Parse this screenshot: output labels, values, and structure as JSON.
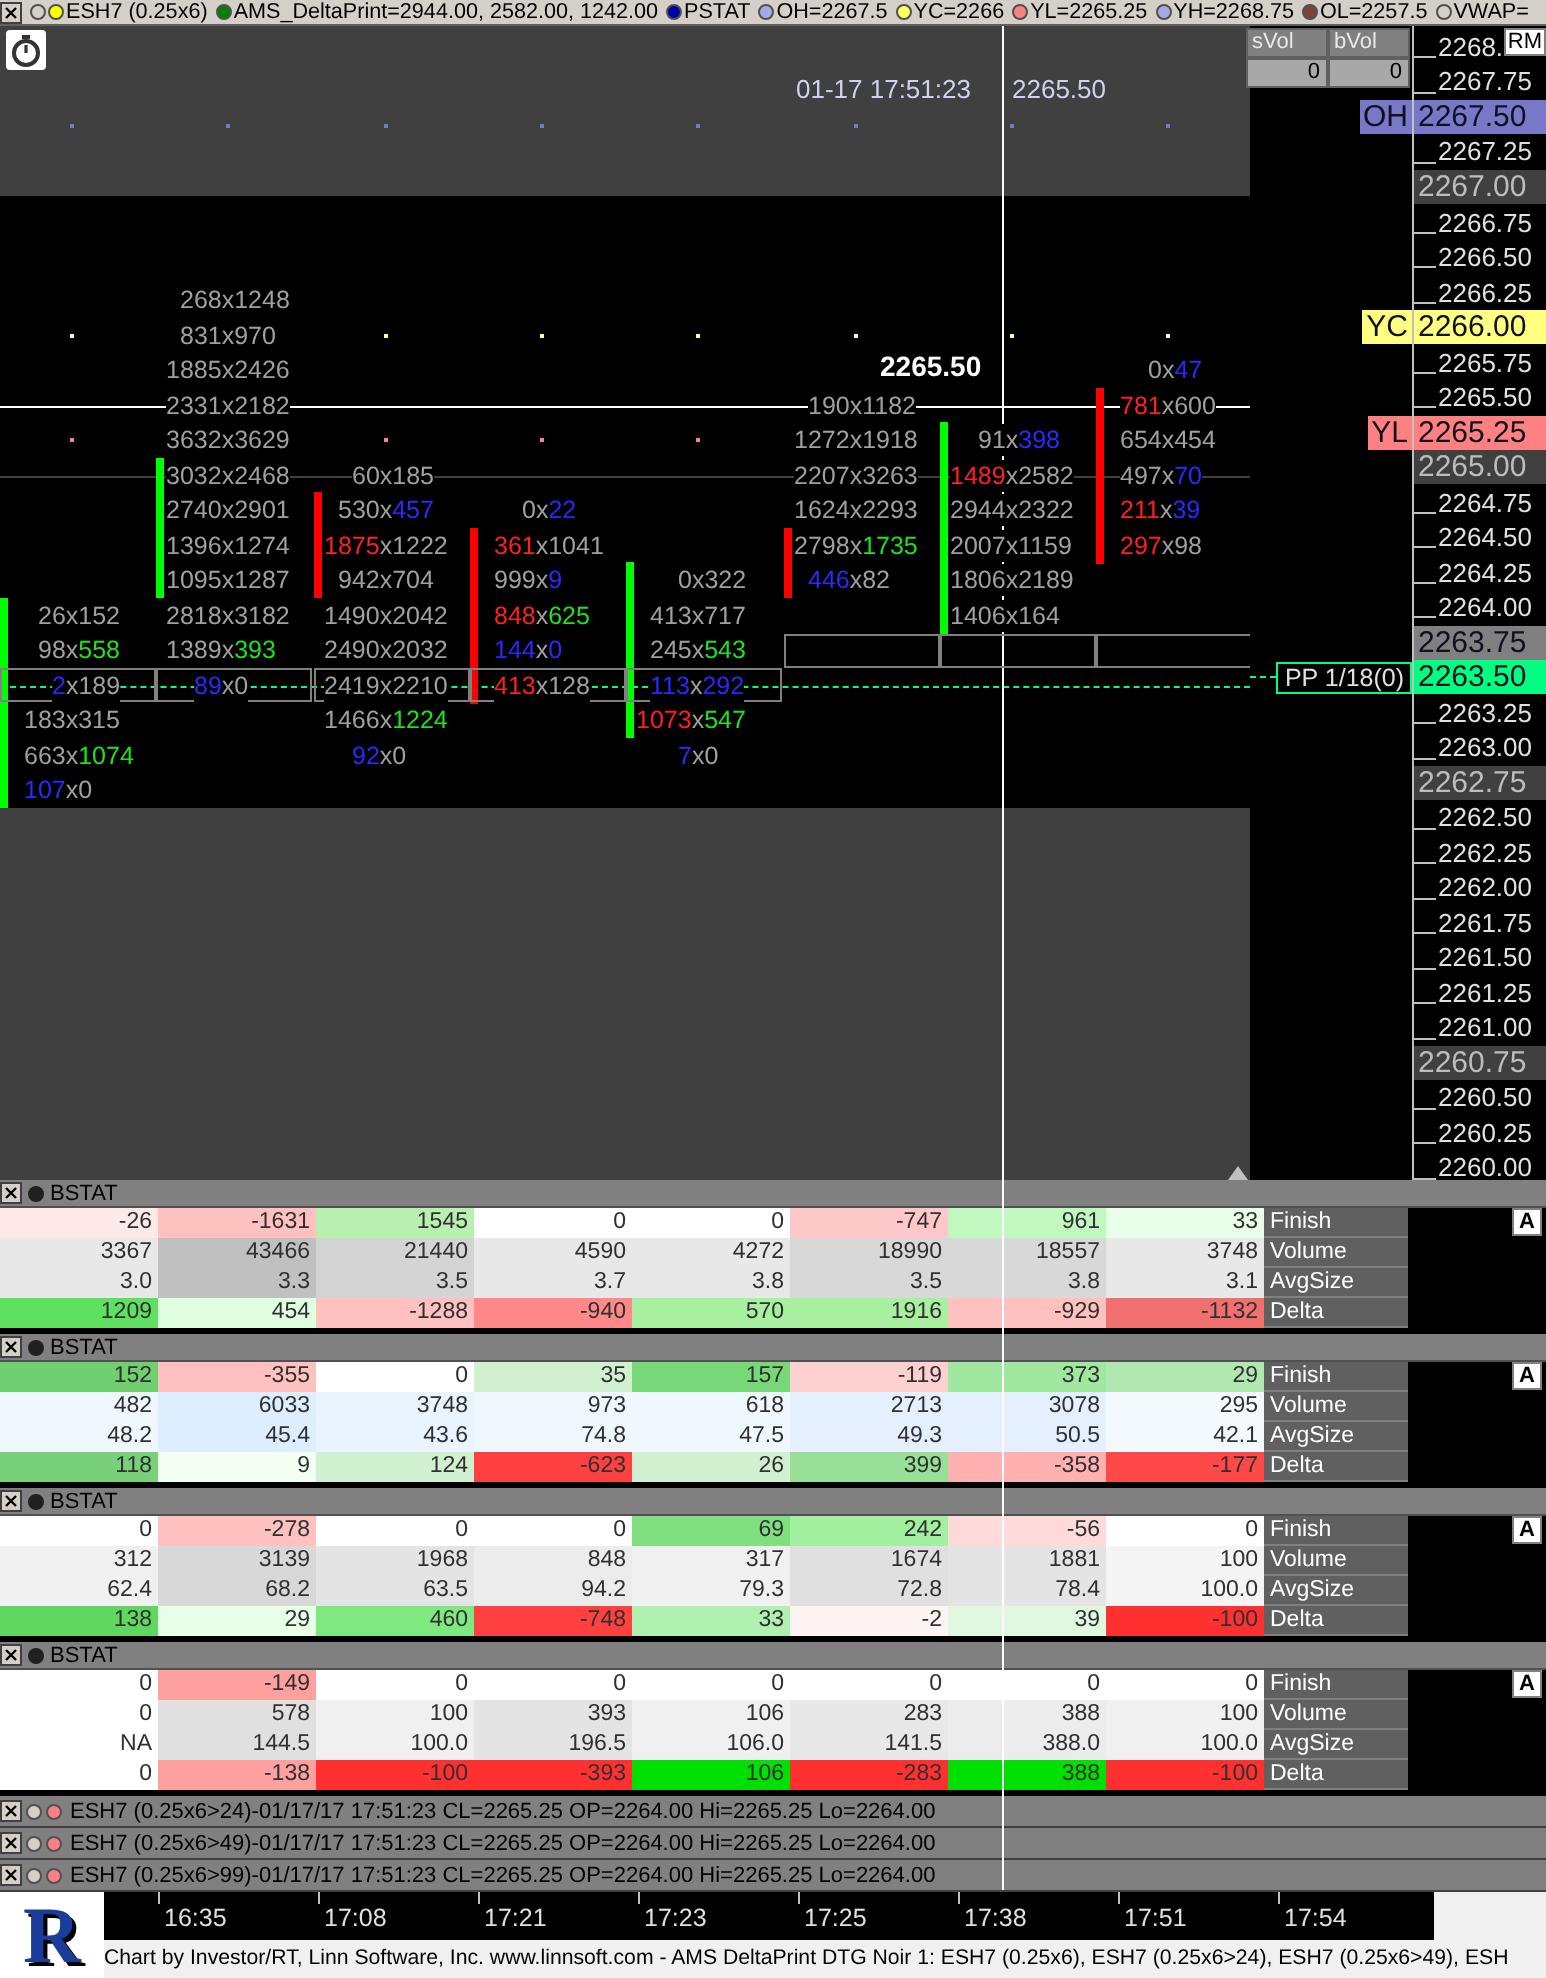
{
  "legend": {
    "items": [
      {
        "dots": [
          {
            "color": "#d4d0c8"
          },
          {
            "color": "#ffff00"
          }
        ],
        "text": "ESH7 (0.25x6)"
      },
      {
        "dots": [
          {
            "color": "#008000"
          }
        ],
        "text": "AMS_DeltaPrint=2944.00, 2582.00, 1242.00"
      },
      {
        "dots": [
          {
            "color": "#0000a0"
          }
        ],
        "text": "PSTAT"
      },
      {
        "dots": [
          {
            "color": "#a8a8e8"
          }
        ],
        "text": "OH=2267.5"
      },
      {
        "dots": [
          {
            "color": "#ffff60"
          }
        ],
        "text": "YC=2266"
      },
      {
        "dots": [
          {
            "color": "#ff8080"
          }
        ],
        "text": "YL=2265.25"
      },
      {
        "dots": [
          {
            "color": "#a8a8e8"
          }
        ],
        "text": "YH=2268.75"
      },
      {
        "dots": [
          {
            "color": "#804040"
          }
        ],
        "text": "OL=2257.5"
      },
      {
        "dots": [
          {
            "color": "#d4d0c8"
          }
        ],
        "text": "VWAP="
      }
    ]
  },
  "chart": {
    "crosshair": {
      "time": "01-17 17:51:23",
      "price": "2265.50",
      "label": "2265.50"
    },
    "volume_table": {
      "columns": [
        "sVol",
        "bVol"
      ],
      "values": [
        "0",
        "0"
      ]
    },
    "axis_button": "RM",
    "ticks": [
      {
        "label": "2268.",
        "kind": "plain"
      },
      {
        "label": "2267.75",
        "kind": "plain"
      },
      {
        "label": "2267.50",
        "color": "#7878c8",
        "tag": "OH",
        "kind": "tag_dots"
      },
      {
        "label": "2267.25",
        "kind": "plain"
      },
      {
        "label": "2267.00",
        "color": "#404040",
        "kind": "range_edge"
      },
      {
        "label": "2266.75",
        "kind": "plain"
      },
      {
        "label": "2266.50",
        "kind": "plain"
      },
      {
        "label": "2266.25",
        "kind": "plain"
      },
      {
        "label": "2266.00",
        "color": "#ffff80",
        "tag": "YC",
        "kind": "tag_dots"
      },
      {
        "label": "2265.75",
        "kind": "plain"
      },
      {
        "label": "2265.50",
        "kind": "crosshair"
      },
      {
        "label": "2265.25",
        "color": "#ff8080",
        "tag": "YL",
        "kind": "tag_dots"
      },
      {
        "label": "2265.00",
        "color": "#404040",
        "kind": "line"
      },
      {
        "label": "2264.75",
        "kind": "plain"
      },
      {
        "label": "2264.50",
        "kind": "plain"
      },
      {
        "label": "2264.25",
        "kind": "plain"
      },
      {
        "label": "2264.00",
        "kind": "plain"
      },
      {
        "label": "2263.75",
        "color": "#808080",
        "kind": "plain"
      },
      {
        "label": "2263.50",
        "color": "#00ff80",
        "tag": "PP 1/18(0)",
        "kind": "tag_dashed"
      },
      {
        "label": "2263.25",
        "kind": "plain"
      },
      {
        "label": "2263.00",
        "kind": "plain"
      },
      {
        "label": "2262.75",
        "color": "#404040",
        "kind": "range_edge"
      },
      {
        "label": "2262.50",
        "kind": "plain"
      },
      {
        "label": "2262.25",
        "kind": "plain"
      },
      {
        "label": "2262.00",
        "kind": "plain"
      },
      {
        "label": "2261.75",
        "kind": "plain"
      },
      {
        "label": "2261.50",
        "kind": "plain"
      },
      {
        "label": "2261.25",
        "kind": "plain"
      },
      {
        "label": "2261.00",
        "kind": "plain"
      },
      {
        "label": "2260.75",
        "color": "#404040",
        "kind": "plain"
      },
      {
        "label": "2260.50",
        "kind": "plain"
      },
      {
        "label": "2260.25",
        "kind": "plain"
      },
      {
        "label": "2260.00",
        "kind": "plain"
      }
    ],
    "footprint": {
      "columns": [
        {
          "color": "#00ff00",
          "cells": [
            null,
            null,
            null,
            null,
            null,
            null,
            null,
            null,
            null,
            {
              "text": "26x152",
              "bid": {
                "color": "#a0a0a0"
              },
              "ask": {
                "color": "#a0a0a0"
              },
              "body": true,
              "outlined": false
            },
            {
              "text": "98x558",
              "bid": {
                "color": "#a0a0a0"
              },
              "ask": {
                "color": "#20e020"
              },
              "body": true,
              "outlined": false
            },
            {
              "text": "2x189",
              "bid": {
                "color": "#2a2aff"
              },
              "ask": {
                "color": "#a0a0a0"
              },
              "body": true,
              "outlined": true
            },
            {
              "text": "183x315",
              "bid": {
                "color": "#a0a0a0"
              },
              "ask": {
                "color": "#a0a0a0"
              },
              "body": true,
              "outlined": false
            },
            {
              "text": "663x1074",
              "bid": {
                "color": "#a0a0a0"
              },
              "ask": {
                "color": "#20e020"
              },
              "body": true,
              "outlined": false
            },
            {
              "text": "107x0",
              "bid": {
                "color": "#2a2aff"
              },
              "ask": {
                "color": "#a0a0a0"
              },
              "body": true,
              "outlined": false
            }
          ]
        },
        {
          "color": "#00ff00",
          "cells": [
            {
              "text": "268x1248",
              "bid": {
                "color": "#a0a0a0"
              },
              "ask": {
                "color": "#a0a0a0"
              },
              "body": false,
              "outlined": false
            },
            {
              "text": "831x970",
              "bid": {
                "color": "#a0a0a0"
              },
              "ask": {
                "color": "#a0a0a0"
              },
              "body": false,
              "outlined": false
            },
            {
              "text": "1885x2426",
              "bid": {
                "color": "#a0a0a0"
              },
              "ask": {
                "color": "#a0a0a0"
              },
              "body": false,
              "outlined": false
            },
            {
              "text": "2331x2182",
              "bid": {
                "color": "#a0a0a0"
              },
              "ask": {
                "color": "#a0a0a0"
              },
              "body": false,
              "outlined": false
            },
            {
              "text": "3632x3629",
              "bid": {
                "color": "#a0a0a0"
              },
              "ask": {
                "color": "#a0a0a0"
              },
              "body": false,
              "outlined": false
            },
            {
              "text": "3032x2468",
              "bid": {
                "color": "#a0a0a0"
              },
              "ask": {
                "color": "#a0a0a0"
              },
              "body": true,
              "outlined": false
            },
            {
              "text": "2740x2901",
              "bid": {
                "color": "#a0a0a0"
              },
              "ask": {
                "color": "#a0a0a0"
              },
              "body": true,
              "outlined": false
            },
            {
              "text": "1396x1274",
              "bid": {
                "color": "#a0a0a0"
              },
              "ask": {
                "color": "#a0a0a0"
              },
              "body": true,
              "outlined": false
            },
            {
              "text": "1095x1287",
              "bid": {
                "color": "#a0a0a0"
              },
              "ask": {
                "color": "#a0a0a0"
              },
              "body": true,
              "outlined": false
            },
            {
              "text": "2818x3182",
              "bid": {
                "color": "#a0a0a0"
              },
              "ask": {
                "color": "#a0a0a0"
              },
              "body": false,
              "outlined": false
            },
            {
              "text": "1389x393",
              "bid": {
                "color": "#a0a0a0"
              },
              "ask": {
                "color": "#20e020"
              },
              "body": false,
              "outlined": false
            },
            {
              "text": "89x0",
              "bid": {
                "color": "#2a2aff"
              },
              "ask": {
                "color": "#a0a0a0"
              },
              "body": false,
              "outlined": true
            }
          ]
        },
        {
          "color": "#ff0000",
          "cells": [
            null,
            null,
            null,
            null,
            null,
            {
              "text": "60x185",
              "bid": {
                "color": "#a0a0a0"
              },
              "ask": {
                "color": "#a0a0a0"
              },
              "body": false,
              "outlined": false
            },
            {
              "text": "530x457",
              "bid": {
                "color": "#a0a0a0"
              },
              "ask": {
                "color": "#2a2aff"
              },
              "body": true,
              "outlined": false
            },
            {
              "text": "1875x1222",
              "bid": {
                "color": "#ff2020"
              },
              "ask": {
                "color": "#a0a0a0"
              },
              "body": true,
              "outlined": false
            },
            {
              "text": "942x704",
              "bid": {
                "color": "#a0a0a0"
              },
              "ask": {
                "color": "#a0a0a0"
              },
              "body": true,
              "outlined": false
            },
            {
              "text": "1490x2042",
              "bid": {
                "color": "#a0a0a0"
              },
              "ask": {
                "color": "#a0a0a0"
              },
              "body": false,
              "outlined": false
            },
            {
              "text": "2490x2032",
              "bid": {
                "color": "#a0a0a0"
              },
              "ask": {
                "color": "#a0a0a0"
              },
              "body": false,
              "outlined": false
            },
            {
              "text": "2419x2210",
              "bid": {
                "color": "#a0a0a0"
              },
              "ask": {
                "color": "#a0a0a0"
              },
              "body": false,
              "outlined": true
            },
            {
              "text": "1466x1224",
              "bid": {
                "color": "#a0a0a0"
              },
              "ask": {
                "color": "#20e020"
              },
              "body": false,
              "outlined": false
            },
            {
              "text": "92x0",
              "bid": {
                "color": "#2a2aff"
              },
              "ask": {
                "color": "#a0a0a0"
              },
              "body": false,
              "outlined": false
            }
          ]
        },
        {
          "color": "#ff0000",
          "cells": [
            null,
            null,
            null,
            null,
            null,
            null,
            {
              "text": "0x22",
              "bid": {
                "color": "#a0a0a0"
              },
              "ask": {
                "color": "#2a2aff"
              },
              "body": false,
              "outlined": false
            },
            {
              "text": "361x1041",
              "bid": {
                "color": "#ff2020"
              },
              "ask": {
                "color": "#a0a0a0"
              },
              "body": true,
              "outlined": false
            },
            {
              "text": "999x9",
              "bid": {
                "color": "#a0a0a0"
              },
              "ask": {
                "color": "#2a2aff"
              },
              "body": true,
              "outlined": false
            },
            {
              "text": "848x625",
              "bid": {
                "color": "#ff2020"
              },
              "ask": {
                "color": "#20e020"
              },
              "body": true,
              "outlined": false
            },
            {
              "text": "144x0",
              "bid": {
                "color": "#2a2aff"
              },
              "ask": {
                "color": "#2a2aff"
              },
              "body": true,
              "outlined": false
            },
            {
              "text": "413x128",
              "bid": {
                "color": "#ff2020"
              },
              "ask": {
                "color": "#a0a0a0"
              },
              "body": true,
              "outlined": true
            }
          ]
        },
        {
          "color": "#00ff00",
          "cells": [
            null,
            null,
            null,
            null,
            null,
            null,
            null,
            null,
            {
              "text": "0x322",
              "bid": {
                "color": "#a0a0a0"
              },
              "ask": {
                "color": "#a0a0a0"
              },
              "body": true,
              "outlined": false
            },
            {
              "text": "413x717",
              "bid": {
                "color": "#a0a0a0"
              },
              "ask": {
                "color": "#a0a0a0"
              },
              "body": true,
              "outlined": false
            },
            {
              "text": "245x543",
              "bid": {
                "color": "#a0a0a0"
              },
              "ask": {
                "color": "#20e020"
              },
              "body": true,
              "outlined": false
            },
            {
              "text": "113x292",
              "bid": {
                "color": "#2a2aff"
              },
              "ask": {
                "color": "#2a2aff"
              },
              "body": true,
              "outlined": true
            },
            {
              "text": "1073x547",
              "bid": {
                "color": "#ff2020"
              },
              "ask": {
                "color": "#20e020"
              },
              "body": true,
              "outlined": false
            },
            {
              "text": "7x0",
              "bid": {
                "color": "#2a2aff"
              },
              "ask": {
                "color": "#a0a0a0"
              },
              "body": false,
              "outlined": false
            }
          ]
        },
        {
          "color": "#ff0000",
          "cells": [
            null,
            null,
            null,
            {
              "text": "190x1182",
              "bid": {
                "color": "#a0a0a0"
              },
              "ask": {
                "color": "#a0a0a0"
              },
              "body": false,
              "outlined": false
            },
            {
              "text": "1272x1918",
              "bid": {
                "color": "#a0a0a0"
              },
              "ask": {
                "color": "#a0a0a0"
              },
              "body": false,
              "outlined": false
            },
            {
              "text": "2207x3263",
              "bid": {
                "color": "#a0a0a0"
              },
              "ask": {
                "color": "#a0a0a0"
              },
              "body": false,
              "outlined": false
            },
            {
              "text": "1624x2293",
              "bid": {
                "color": "#a0a0a0"
              },
              "ask": {
                "color": "#a0a0a0"
              },
              "body": false,
              "outlined": false
            },
            {
              "text": "2798x1735",
              "bid": {
                "color": "#a0a0a0"
              },
              "ask": {
                "color": "#20e020"
              },
              "body": true,
              "outlined": false
            },
            {
              "text": "446x82",
              "bid": {
                "color": "#2a2aff"
              },
              "ask": {
                "color": "#a0a0a0"
              },
              "body": true,
              "outlined": false
            },
            null,
            {
              "body": false,
              "outlined": true
            }
          ]
        },
        {
          "color": "#00ff00",
          "cells": [
            null,
            null,
            null,
            null,
            {
              "text": "91x398",
              "bid": {
                "color": "#a0a0a0"
              },
              "ask": {
                "color": "#2a2aff"
              },
              "body": true,
              "outlined": false
            },
            {
              "text": "1489x2582",
              "bid": {
                "color": "#ff2020"
              },
              "ask": {
                "color": "#a0a0a0"
              },
              "body": true,
              "outlined": false
            },
            {
              "text": "2944x2322",
              "bid": {
                "color": "#a0a0a0"
              },
              "ask": {
                "color": "#a0a0a0"
              },
              "body": true,
              "outlined": false
            },
            {
              "text": "2007x1159",
              "bid": {
                "color": "#a0a0a0"
              },
              "ask": {
                "color": "#a0a0a0"
              },
              "body": true,
              "outlined": false
            },
            {
              "text": "1806x2189",
              "bid": {
                "color": "#a0a0a0"
              },
              "ask": {
                "color": "#a0a0a0"
              },
              "body": true,
              "outlined": false
            },
            {
              "text": "1406x164",
              "bid": {
                "color": "#a0a0a0"
              },
              "ask": {
                "color": "#a0a0a0"
              },
              "body": true,
              "outlined": false
            },
            {
              "body": false,
              "outlined": true
            }
          ]
        },
        {
          "color": "#ff0000",
          "cells": [
            null,
            null,
            {
              "text": "0x47",
              "bid": {
                "color": "#a0a0a0"
              },
              "ask": {
                "color": "#2a2aff"
              },
              "body": false,
              "outlined": false
            },
            {
              "text": "781x600",
              "bid": {
                "color": "#ff2020"
              },
              "ask": {
                "color": "#a0a0a0"
              },
              "body": true,
              "outlined": false
            },
            {
              "text": "654x454",
              "bid": {
                "color": "#a0a0a0"
              },
              "ask": {
                "color": "#a0a0a0"
              },
              "body": true,
              "outlined": false
            },
            {
              "text": "497x70",
              "bid": {
                "color": "#a0a0a0"
              },
              "ask": {
                "color": "#2a2aff"
              },
              "body": true,
              "outlined": false
            },
            {
              "text": "211x39",
              "bid": {
                "color": "#ff2020"
              },
              "ask": {
                "color": "#2a2aff"
              },
              "body": true,
              "outlined": false
            },
            {
              "text": "297x98",
              "bid": {
                "color": "#ff2020"
              },
              "ask": {
                "color": "#a0a0a0"
              },
              "body": true,
              "outlined": false
            },
            null,
            null,
            {
              "body": false,
              "outlined": true
            }
          ]
        }
      ]
    }
  },
  "panels": [
    {
      "title": "BSTAT",
      "dot": {
        "color": "#202020"
      },
      "button": "A",
      "rows": [
        {
          "label": "Finish",
          "cells": [
            {
              "value": "-26",
              "color": "#ffe8e8"
            },
            {
              "value": "-1631",
              "color": "#ffc0c0"
            },
            {
              "value": "1545",
              "color": "#b8f0b0"
            },
            {
              "value": "0",
              "color": "#ffffff"
            },
            {
              "value": "0",
              "color": "#ffffff"
            },
            {
              "value": "-747",
              "color": "#ffc8c8"
            },
            {
              "value": "961",
              "color": "#c0f8c0"
            },
            {
              "value": "33",
              "color": "#e8ffe8"
            }
          ]
        },
        {
          "label": "Volume",
          "cells": [
            {
              "value": "3367",
              "color": "#e8e8e8"
            },
            {
              "value": "43466",
              "color": "#c0c0c0"
            },
            {
              "value": "21440",
              "color": "#d4d4d4"
            },
            {
              "value": "4590",
              "color": "#e8e8e8"
            },
            {
              "value": "4272",
              "color": "#e8e8e8"
            },
            {
              "value": "18990",
              "color": "#d8d8d8"
            },
            {
              "value": "18557",
              "color": "#d8d8d8"
            },
            {
              "value": "3748",
              "color": "#e8e8e8"
            }
          ]
        },
        {
          "label": "AvgSize",
          "cells": [
            {
              "value": "3.0",
              "color": "#e8e8e8"
            },
            {
              "value": "3.3",
              "color": "#c0c0c0"
            },
            {
              "value": "3.5",
              "color": "#d4d4d4"
            },
            {
              "value": "3.7",
              "color": "#e8e8e8"
            },
            {
              "value": "3.8",
              "color": "#e8e8e8"
            },
            {
              "value": "3.5",
              "color": "#d8d8d8"
            },
            {
              "value": "3.8",
              "color": "#d8d8d8"
            },
            {
              "value": "3.1",
              "color": "#e8e8e8"
            }
          ]
        },
        {
          "label": "Delta",
          "cells": [
            {
              "value": "1209",
              "color": "#60e060"
            },
            {
              "value": "454",
              "color": "#e0ffe0"
            },
            {
              "value": "-1288",
              "color": "#ffc0c0"
            },
            {
              "value": "-940",
              "color": "#ff8888"
            },
            {
              "value": "570",
              "color": "#a8f0a0"
            },
            {
              "value": "1916",
              "color": "#a8f0a0"
            },
            {
              "value": "-929",
              "color": "#ffc0c0"
            },
            {
              "value": "-1132",
              "color": "#f07070"
            }
          ]
        }
      ]
    },
    {
      "title": "BSTAT",
      "dot": {
        "color": "#202020"
      },
      "button": "A",
      "rows": [
        {
          "label": "Finish",
          "cells": [
            {
              "value": "152",
              "color": "#70d070"
            },
            {
              "value": "-355",
              "color": "#ffc0c0"
            },
            {
              "value": "0",
              "color": "#ffffff"
            },
            {
              "value": "35",
              "color": "#d0f0d0"
            },
            {
              "value": "157",
              "color": "#78d878"
            },
            {
              "value": "-119",
              "color": "#ffd0d0"
            },
            {
              "value": "373",
              "color": "#a0e8a0"
            },
            {
              "value": "29",
              "color": "#b0e8b0"
            }
          ]
        },
        {
          "label": "Volume",
          "cells": [
            {
              "value": "482",
              "color": "#f0f8ff"
            },
            {
              "value": "6033",
              "color": "#dceeff"
            },
            {
              "value": "3748",
              "color": "#eaf4ff"
            },
            {
              "value": "973",
              "color": "#f0f8ff"
            },
            {
              "value": "618",
              "color": "#f0f8ff"
            },
            {
              "value": "2713",
              "color": "#e4f0ff"
            },
            {
              "value": "3078",
              "color": "#e4f0ff"
            },
            {
              "value": "295",
              "color": "#f4f8ff"
            }
          ]
        },
        {
          "label": "AvgSize",
          "cells": [
            {
              "value": "48.2",
              "color": "#f0f8ff"
            },
            {
              "value": "45.4",
              "color": "#dceeff"
            },
            {
              "value": "43.6",
              "color": "#eaf4ff"
            },
            {
              "value": "74.8",
              "color": "#f0f8ff"
            },
            {
              "value": "47.5",
              "color": "#f0f8ff"
            },
            {
              "value": "49.3",
              "color": "#e4f0ff"
            },
            {
              "value": "50.5",
              "color": "#e4f0ff"
            },
            {
              "value": "42.1",
              "color": "#f4f8ff"
            }
          ]
        },
        {
          "label": "Delta",
          "cells": [
            {
              "value": "118",
              "color": "#78d078"
            },
            {
              "value": "9",
              "color": "#f4fff4"
            },
            {
              "value": "124",
              "color": "#d0f0d0"
            },
            {
              "value": "-623",
              "color": "#ff4040"
            },
            {
              "value": "26",
              "color": "#d0f0d0"
            },
            {
              "value": "399",
              "color": "#98e098"
            },
            {
              "value": "-358",
              "color": "#ffb0b0"
            },
            {
              "value": "-177",
              "color": "#ff4848"
            }
          ]
        }
      ]
    },
    {
      "title": "BSTAT",
      "dot": {
        "color": "#202020"
      },
      "button": "A",
      "rows": [
        {
          "label": "Finish",
          "cells": [
            {
              "value": "0",
              "color": "#ffffff"
            },
            {
              "value": "-278",
              "color": "#ffc0c0"
            },
            {
              "value": "0",
              "color": "#ffffff"
            },
            {
              "value": "0",
              "color": "#ffffff"
            },
            {
              "value": "69",
              "color": "#80e080"
            },
            {
              "value": "242",
              "color": "#a0f0a0"
            },
            {
              "value": "-56",
              "color": "#ffdada"
            },
            {
              "value": "0",
              "color": "#ffffff"
            }
          ]
        },
        {
          "label": "Volume",
          "cells": [
            {
              "value": "312",
              "color": "#f0f0f0"
            },
            {
              "value": "3139",
              "color": "#d8d8d8"
            },
            {
              "value": "1968",
              "color": "#e4e4e4"
            },
            {
              "value": "848",
              "color": "#ececec"
            },
            {
              "value": "317",
              "color": "#f0f0f0"
            },
            {
              "value": "1674",
              "color": "#e0e0e0"
            },
            {
              "value": "1881",
              "color": "#e4e4e4"
            },
            {
              "value": "100",
              "color": "#f4f4f4"
            }
          ]
        },
        {
          "label": "AvgSize",
          "cells": [
            {
              "value": "62.4",
              "color": "#f0f0f0"
            },
            {
              "value": "68.2",
              "color": "#d8d8d8"
            },
            {
              "value": "63.5",
              "color": "#e4e4e4"
            },
            {
              "value": "94.2",
              "color": "#ececec"
            },
            {
              "value": "79.3",
              "color": "#f0f0f0"
            },
            {
              "value": "72.8",
              "color": "#e0e0e0"
            },
            {
              "value": "78.4",
              "color": "#e4e4e4"
            },
            {
              "value": "100.0",
              "color": "#f4f4f4"
            }
          ]
        },
        {
          "label": "Delta",
          "cells": [
            {
              "value": "138",
              "color": "#60d860"
            },
            {
              "value": "29",
              "color": "#e8ffe8"
            },
            {
              "value": "460",
              "color": "#80e880"
            },
            {
              "value": "-748",
              "color": "#ff4040"
            },
            {
              "value": "33",
              "color": "#b0f0b0"
            },
            {
              "value": "-2",
              "color": "#fff4f4"
            },
            {
              "value": "39",
              "color": "#e0f8e0"
            },
            {
              "value": "-100",
              "color": "#ff3030"
            }
          ]
        }
      ]
    },
    {
      "title": "BSTAT",
      "dot": {
        "color": "#202020"
      },
      "button": "A",
      "rows": [
        {
          "label": "Finish",
          "cells": [
            {
              "value": "0",
              "color": "#ffffff"
            },
            {
              "value": "-149",
              "color": "#ffa0a0"
            },
            {
              "value": "0",
              "color": "#ffffff"
            },
            {
              "value": "0",
              "color": "#ffffff"
            },
            {
              "value": "0",
              "color": "#ffffff"
            },
            {
              "value": "0",
              "color": "#ffffff"
            },
            {
              "value": "0",
              "color": "#ffffff"
            },
            {
              "value": "0",
              "color": "#ffffff"
            }
          ]
        },
        {
          "label": "Volume",
          "cells": [
            {
              "value": "0",
              "color": "#ffffff"
            },
            {
              "value": "578",
              "color": "#e0e0e0"
            },
            {
              "value": "100",
              "color": "#f0f0f0"
            },
            {
              "value": "393",
              "color": "#e4e4e4"
            },
            {
              "value": "106",
              "color": "#f0f0f0"
            },
            {
              "value": "283",
              "color": "#e8e8e8"
            },
            {
              "value": "388",
              "color": "#ececec"
            },
            {
              "value": "100",
              "color": "#f0f0f0"
            }
          ]
        },
        {
          "label": "AvgSize",
          "cells": [
            {
              "value": "NA",
              "color": "#ffffff"
            },
            {
              "value": "144.5",
              "color": "#e0e0e0"
            },
            {
              "value": "100.0",
              "color": "#f0f0f0"
            },
            {
              "value": "196.5",
              "color": "#e4e4e4"
            },
            {
              "value": "106.0",
              "color": "#f0f0f0"
            },
            {
              "value": "141.5",
              "color": "#e8e8e8"
            },
            {
              "value": "388.0",
              "color": "#ececec"
            },
            {
              "value": "100.0",
              "color": "#f0f0f0"
            }
          ]
        },
        {
          "label": "Delta",
          "cells": [
            {
              "value": "0",
              "color": "#ffffff"
            },
            {
              "value": "-138",
              "color": "#ffa0a0"
            },
            {
              "value": "-100",
              "color": "#ff3030"
            },
            {
              "value": "-393",
              "color": "#ff3030"
            },
            {
              "value": "106",
              "color": "#00e000"
            },
            {
              "value": "-283",
              "color": "#ff3030"
            },
            {
              "value": "388",
              "color": "#00e000"
            },
            {
              "value": "-100",
              "color": "#ff3030"
            }
          ]
        }
      ]
    }
  ],
  "studies": [
    {
      "dots": [
        {
          "color": "#d4d0c8"
        },
        {
          "color": "#ff8080"
        }
      ],
      "text": "ESH7 (0.25x6>24)-01/17/17 17:51:23 CL=2265.25 OP=2264.00 Hi=2265.25 Lo=2264.00"
    },
    {
      "dots": [
        {
          "color": "#d4d0c8"
        },
        {
          "color": "#ff8080"
        }
      ],
      "text": "ESH7 (0.25x6>49)-01/17/17 17:51:23 CL=2265.25 OP=2264.00 Hi=2265.25 Lo=2264.00"
    },
    {
      "dots": [
        {
          "color": "#d4d0c8"
        },
        {
          "color": "#ff8080"
        }
      ],
      "text": "ESH7 (0.25x6>99)-01/17/17 17:51:23 CL=2265.25 OP=2264.00 Hi=2265.25 Lo=2264.00"
    }
  ],
  "bottom": {
    "logo": "R",
    "times": [
      "16:35",
      "17:08",
      "17:21",
      "17:23",
      "17:25",
      "17:38",
      "17:51",
      "17:54"
    ],
    "footer": "Chart by Investor/RT, Linn Software, Inc. www.linnsoft.com - AMS DeltaPrint DTG Noir 1: ESH7 (0.25x6), ESH7 (0.25x6>24), ESH7 (0.25x6>49), ESH"
  }
}
